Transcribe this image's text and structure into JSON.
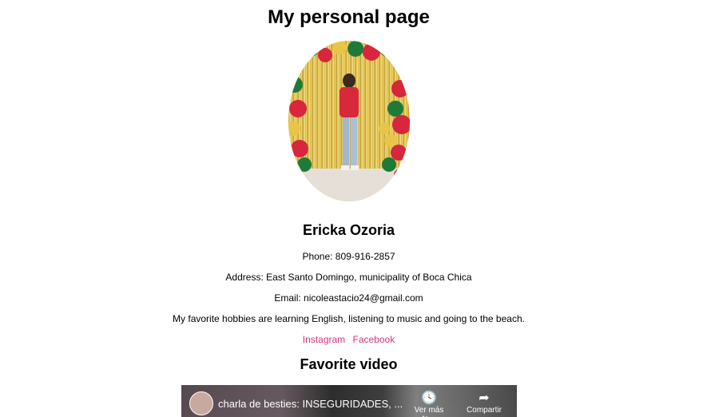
{
  "page": {
    "title": "My personal page"
  },
  "profile": {
    "name": "Ericka Ozoria",
    "phone": "Phone: 809-916-2857",
    "address": "Address: East Santo Domingo, municipality of Boca Chica",
    "email": "Email: nicoleastacio24@gmail.com",
    "hobbies": "My favorite hobbies are learning English, listening to music and going to the beach."
  },
  "links": [
    {
      "label": "Instagram"
    },
    {
      "label": "Facebook"
    }
  ],
  "video_section": {
    "heading": "Favorite video",
    "video_title": "charla de besties: INSEGURIDADES, ...",
    "watch_later_label": "Ver más ta...",
    "share_label": "Compartir"
  },
  "colors": {
    "link": "#d63384"
  }
}
